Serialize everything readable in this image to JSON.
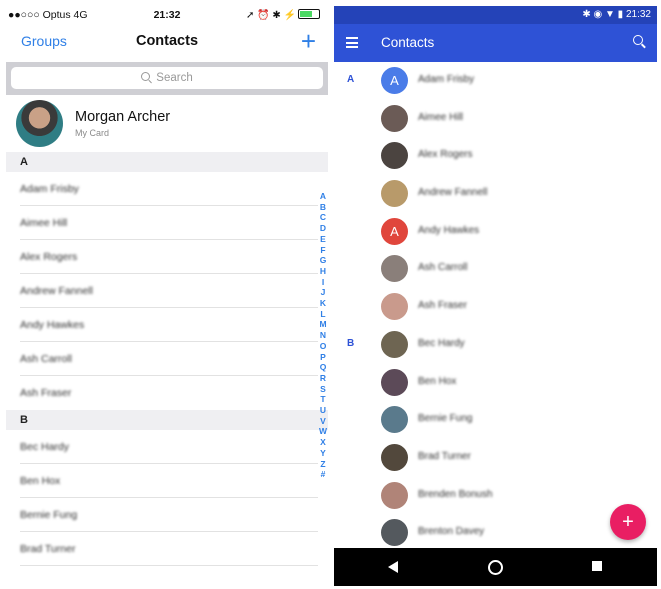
{
  "ios": {
    "status": {
      "carrier": "●●○○○ Optus  4G",
      "time": "21:32",
      "right": "➚ ⏰ ✱ ⚡"
    },
    "nav": {
      "left": "Groups",
      "title": "Contacts",
      "add": "+"
    },
    "search_placeholder": "Search",
    "my_card": {
      "name": "Morgan Archer",
      "subtitle": "My Card"
    },
    "sections": [
      {
        "letter": "A",
        "contacts": [
          "Adam Frisby",
          "Aimee Hill",
          "Alex Rogers",
          "Andrew Fannell",
          "Andy Hawkes",
          "Ash Carroll",
          "Ash Fraser"
        ]
      },
      {
        "letter": "B",
        "contacts": [
          "Bec Hardy",
          "Ben Hox",
          "Bernie Fung",
          "Brad Turner"
        ]
      }
    ],
    "index": [
      "A",
      "B",
      "C",
      "D",
      "E",
      "F",
      "G",
      "H",
      "I",
      "J",
      "K",
      "L",
      "M",
      "N",
      "O",
      "P",
      "Q",
      "R",
      "S",
      "T",
      "U",
      "V",
      "W",
      "X",
      "Y",
      "Z",
      "#"
    ]
  },
  "android": {
    "status": {
      "right": "✱ ◉ ▼ ▮ 21:32"
    },
    "toolbar": {
      "title": "Contacts"
    },
    "contacts": [
      {
        "letter": "A",
        "name": "Adam Frisby",
        "avatar_text": "A",
        "color": "#4a7ce8"
      },
      {
        "letter": "",
        "name": "Aimee Hill",
        "avatar_text": "",
        "color": "#6b5b56"
      },
      {
        "letter": "",
        "name": "Alex Rogers",
        "avatar_text": "",
        "color": "#4b4440"
      },
      {
        "letter": "",
        "name": "Andrew Fannell",
        "avatar_text": "",
        "color": "#b89a6a"
      },
      {
        "letter": "",
        "name": "Andy Hawkes",
        "avatar_text": "A",
        "color": "#e0463c"
      },
      {
        "letter": "",
        "name": "Ash Carroll",
        "avatar_text": "",
        "color": "#8a7f7a"
      },
      {
        "letter": "",
        "name": "Ash Fraser",
        "avatar_text": "",
        "color": "#c99a8c"
      },
      {
        "letter": "B",
        "name": "Bec Hardy",
        "avatar_text": "",
        "color": "#6e6552"
      },
      {
        "letter": "",
        "name": "Ben Hox",
        "avatar_text": "",
        "color": "#5c4a58"
      },
      {
        "letter": "",
        "name": "Bernie Fung",
        "avatar_text": "",
        "color": "#5a7a8c"
      },
      {
        "letter": "",
        "name": "Brad Turner",
        "avatar_text": "",
        "color": "#52483c"
      },
      {
        "letter": "",
        "name": "Brenden Bonush",
        "avatar_text": "",
        "color": "#b08478"
      },
      {
        "letter": "",
        "name": "Brenton Davey",
        "avatar_text": "",
        "color": "#54595e"
      }
    ],
    "fab": "+"
  }
}
